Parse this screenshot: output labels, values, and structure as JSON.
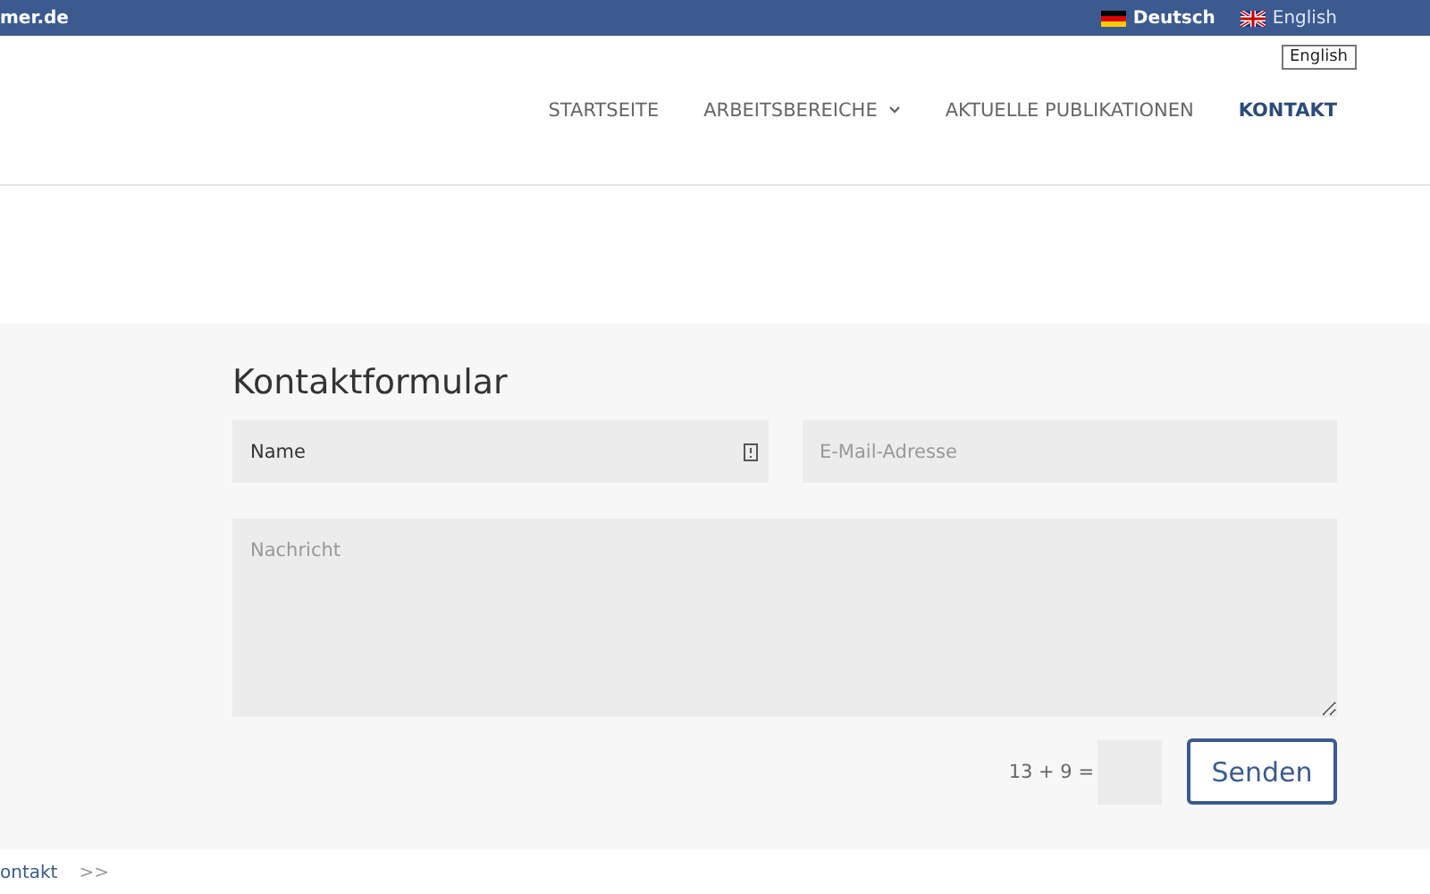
{
  "top_bar": {
    "site": "mer.de",
    "languages": [
      {
        "label": "Deutsch",
        "selected": true
      },
      {
        "label": "English",
        "selected": false
      }
    ],
    "tooltip": "English"
  },
  "nav": {
    "items": [
      {
        "label": "STARTSEITE",
        "selected": false,
        "has_dropdown": false
      },
      {
        "label": "ARBEITSBEREICHE",
        "selected": false,
        "has_dropdown": true
      },
      {
        "label": "AKTUELLE PUBLIKATIONEN",
        "selected": false,
        "has_dropdown": false
      },
      {
        "label": "KONTAKT",
        "selected": true,
        "has_dropdown": false
      }
    ]
  },
  "form": {
    "title": "Kontaktformular",
    "name_field": {
      "value": "Name"
    },
    "email_field": {
      "placeholder": "E-Mail-Adresse"
    },
    "message_field": {
      "placeholder": "Nachricht"
    },
    "captcha": {
      "question": "13 + 9 ="
    },
    "submit": "Senden"
  },
  "breadcrumb": {
    "items": [
      "ontakt"
    ],
    "separator": ">>"
  }
}
